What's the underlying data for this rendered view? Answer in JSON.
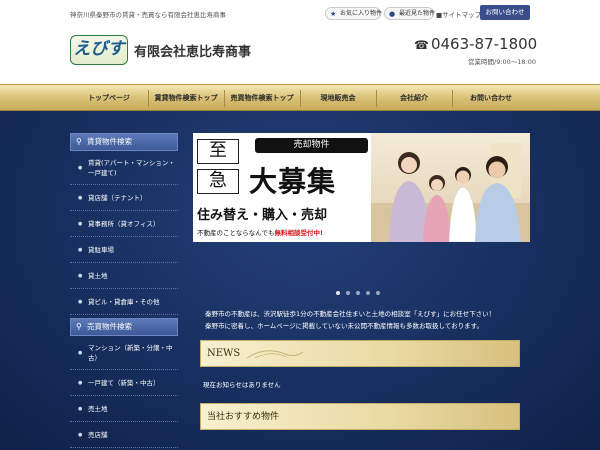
{
  "header": {
    "tagline": "神奈川県秦野市の賃貸・売買なら有限会社恵比寿商事",
    "favorites_label": "お気に入り物件",
    "recent_label": "最近見た物件",
    "sitemap_label": "サイトマップ",
    "contact_label": "お問い合わせ",
    "logo_text": "えびす",
    "company_name": "有限会社恵比寿商事",
    "phone": "0463-87-1800",
    "hours": "営業時間/9:00～18:00"
  },
  "nav": {
    "items": [
      "トップページ",
      "賃貸物件検索トップ",
      "売買物件検索トップ",
      "現地販売会",
      "会社紹介",
      "お問い合わせ"
    ]
  },
  "sidebar": {
    "rent": {
      "title": "賃貸物件検索",
      "items": [
        "賃貸(アパート・マンション・一戸建て)",
        "貸店舗（テナント）",
        "貸事務所（貸オフィス）",
        "貸駐車場",
        "貸土地",
        "貸ビル・貸倉庫・その他"
      ]
    },
    "sale": {
      "title": "売買物件検索",
      "items": [
        "マンション（新築・分譲・中古）",
        "一戸建て（新築・中古）",
        "売土地",
        "売店舗"
      ]
    }
  },
  "banner": {
    "vertical_text": [
      "至",
      "急"
    ],
    "label": "売却物件",
    "headline": "大募集",
    "subline": "住み替え・購入・売却",
    "note_prefix": "不動産のことならなんでも",
    "note_highlight": "無料相談受付中!"
  },
  "intro": {
    "line1": "秦野市の不動産は、渋沢駅徒歩1分の不動産会社住まいと土地の相談室「えびす」にお任せ下さい！",
    "line2": "秦野市に密着し、ホームページに掲載していない未公開不動産情報も多数お取扱しております。"
  },
  "news": {
    "title": "NEWS",
    "empty_text": "現在お知らせはありません"
  },
  "recommend": {
    "title": "当社おすすめ物件"
  },
  "colors": {
    "accent": "#3a4e8c",
    "gold": "#d7bf73",
    "background": "#162d5c",
    "highlight": "#d31818"
  }
}
